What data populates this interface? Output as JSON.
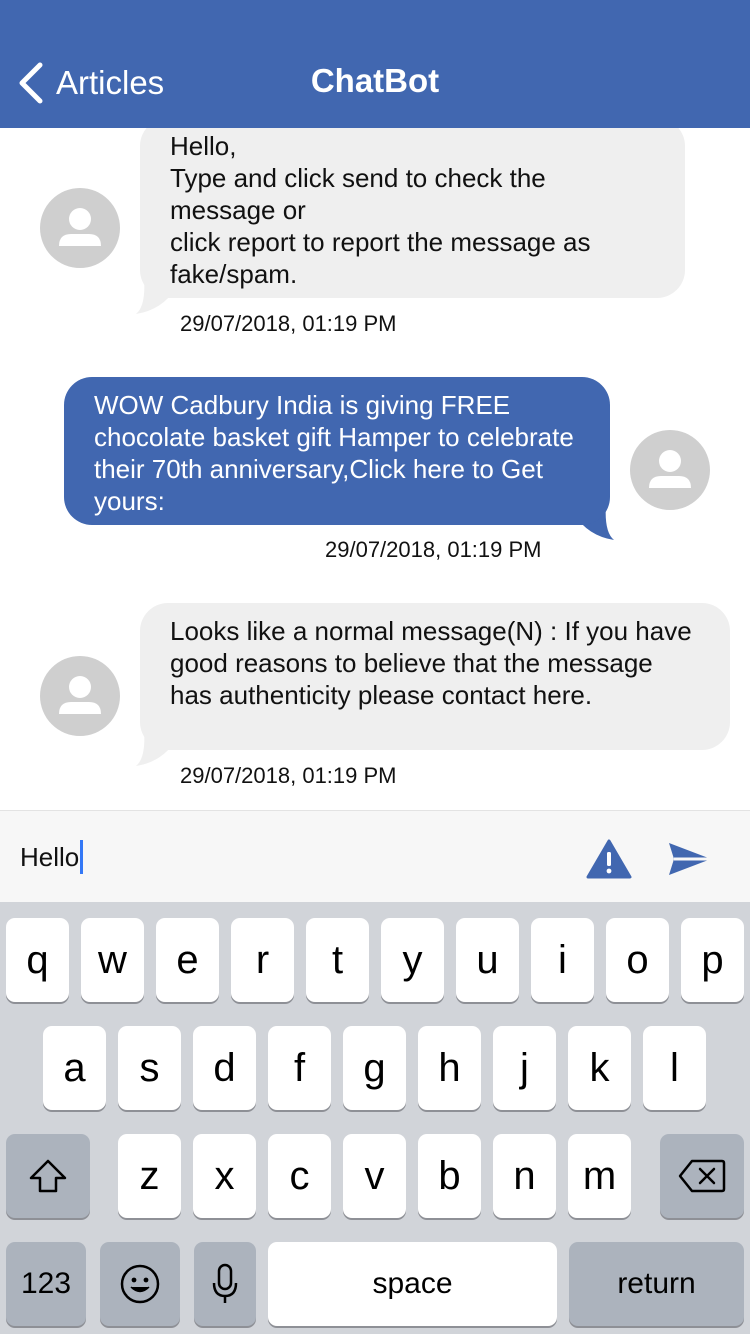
{
  "nav": {
    "back_label": "Articles",
    "title": "ChatBot"
  },
  "messages": [
    {
      "side": "incoming",
      "text": "Hello,\nType and click send to check the message or\nclick report to report the message as fake/spam.",
      "timestamp": "29/07/2018, 01:19 PM"
    },
    {
      "side": "outgoing",
      "text": "WOW Cadbury India is giving FREE chocolate basket gift Hamper to celebrate their 70th anniversary,Click here to Get yours:",
      "timestamp": "29/07/2018, 01:19 PM"
    },
    {
      "side": "incoming",
      "text": "Looks like a normal message(N) : If you have good reasons to believe that the message has authenticity please contact here.",
      "timestamp": "29/07/2018, 01:19 PM"
    }
  ],
  "input": {
    "value": "Hello",
    "report_icon": "warning-icon",
    "send_icon": "send-icon"
  },
  "keyboard": {
    "row1": [
      "q",
      "w",
      "e",
      "r",
      "t",
      "y",
      "u",
      "i",
      "o",
      "p"
    ],
    "row2": [
      "a",
      "s",
      "d",
      "f",
      "g",
      "h",
      "j",
      "k",
      "l"
    ],
    "row3": [
      "z",
      "x",
      "c",
      "v",
      "b",
      "n",
      "m"
    ],
    "numbers_label": "123",
    "space_label": "space",
    "return_label": "return"
  },
  "colors": {
    "brand": "#4167b0",
    "incoming_bubble": "#efefef",
    "keyboard_bg": "#d1d4d9"
  }
}
